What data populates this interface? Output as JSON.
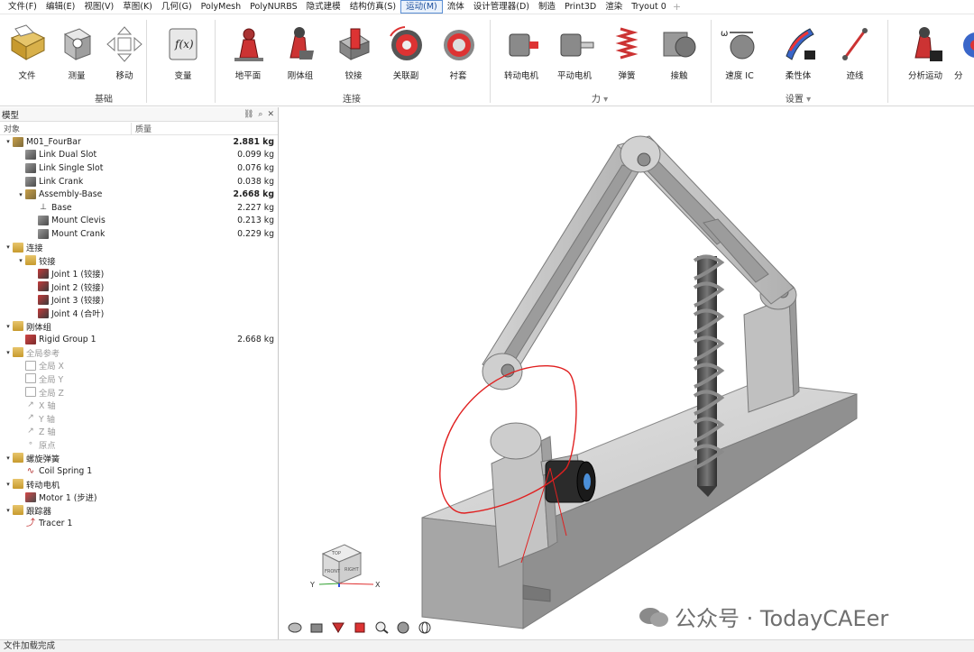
{
  "menu": {
    "items": [
      "文件(F)",
      "编辑(E)",
      "视图(V)",
      "草图(K)",
      "几何(G)",
      "PolyMesh",
      "PolyNURBS",
      "隐式建模",
      "结构仿真(S)",
      "运动(M)",
      "流体",
      "设计管理器(D)",
      "制造",
      "Print3D",
      "渲染",
      "Tryout 0"
    ],
    "active": "运动(M)",
    "plus": "+"
  },
  "ribbon": {
    "buttons": {
      "file": "文件",
      "measure": "测量",
      "move": "移动",
      "variable": "变量",
      "ground": "地平面",
      "rigid_group": "刚体组",
      "hinge": "铰接",
      "coupler": "关联副",
      "bushing": "衬套",
      "rot_motor": "转动电机",
      "lin_motor": "平动电机",
      "spring": "弹簧",
      "contact": "接触",
      "velocity_ic": "速度 IC",
      "flex_body": "柔性体",
      "tracer": "迹线",
      "analyze": "分析运动",
      "analyze2": "分"
    },
    "groups": {
      "basic": "基础",
      "connect": "连接",
      "force": "力",
      "setup": "设置"
    },
    "dropdown_marker": "▾"
  },
  "panel": {
    "title": "模型",
    "tools": [
      "⛓",
      "⌕",
      "✕"
    ],
    "col_object": "对象",
    "col_mass": "质量",
    "tree": [
      {
        "label": "M01_FourBar",
        "value": "2.881 kg",
        "bold": true,
        "depth": 0,
        "chev": "▾",
        "icon": "asm"
      },
      {
        "label": "Link Dual Slot",
        "value": "0.099 kg",
        "depth": 1,
        "chev": "",
        "icon": "part"
      },
      {
        "label": "Link Single Slot",
        "value": "0.076 kg",
        "depth": 1,
        "chev": "",
        "icon": "part"
      },
      {
        "label": "Link Crank",
        "value": "0.038 kg",
        "depth": 1,
        "chev": "",
        "icon": "part"
      },
      {
        "label": "Assembly-Base",
        "value": "2.668 kg",
        "bold": true,
        "depth": 1,
        "chev": "▾",
        "icon": "asm"
      },
      {
        "label": "Base",
        "value": "2.227 kg",
        "depth": 2,
        "chev": "",
        "icon": "ground"
      },
      {
        "label": "Mount Clevis",
        "value": "0.213 kg",
        "depth": 2,
        "chev": "",
        "icon": "part"
      },
      {
        "label": "Mount Crank",
        "value": "0.229 kg",
        "depth": 2,
        "chev": "",
        "icon": "part"
      },
      {
        "label": "连接",
        "value": "",
        "depth": 0,
        "chev": "▾",
        "icon": "folder"
      },
      {
        "label": "铰接",
        "value": "",
        "depth": 1,
        "chev": "▾",
        "icon": "folder"
      },
      {
        "label": "Joint 1 (铰接)",
        "value": "",
        "depth": 2,
        "chev": "",
        "icon": "joint"
      },
      {
        "label": "Joint 2 (铰接)",
        "value": "",
        "depth": 2,
        "chev": "",
        "icon": "joint"
      },
      {
        "label": "Joint 3 (铰接)",
        "value": "",
        "depth": 2,
        "chev": "",
        "icon": "joint"
      },
      {
        "label": "Joint 4 (合叶)",
        "value": "",
        "depth": 2,
        "chev": "",
        "icon": "joint"
      },
      {
        "label": "刚体组",
        "value": "",
        "depth": 0,
        "chev": "▾",
        "icon": "folder"
      },
      {
        "label": "Rigid Group 1",
        "value": "2.668 kg",
        "depth": 1,
        "chev": "",
        "icon": "rigid"
      },
      {
        "label": "全局参考",
        "value": "",
        "depth": 0,
        "chev": "▾",
        "icon": "folder",
        "disabled": true
      },
      {
        "label": "全局 X",
        "value": "",
        "depth": 1,
        "chev": "",
        "icon": "ref",
        "disabled": true
      },
      {
        "label": "全局 Y",
        "value": "",
        "depth": 1,
        "chev": "",
        "icon": "ref",
        "disabled": true
      },
      {
        "label": "全局 Z",
        "value": "",
        "depth": 1,
        "chev": "",
        "icon": "ref",
        "disabled": true
      },
      {
        "label": "X 轴",
        "value": "",
        "depth": 1,
        "chev": "",
        "icon": "axis",
        "disabled": true
      },
      {
        "label": "Y 轴",
        "value": "",
        "depth": 1,
        "chev": "",
        "icon": "axis",
        "disabled": true
      },
      {
        "label": "Z 轴",
        "value": "",
        "depth": 1,
        "chev": "",
        "icon": "axis",
        "disabled": true
      },
      {
        "label": "原点",
        "value": "",
        "depth": 1,
        "chev": "",
        "icon": "origin",
        "disabled": true
      },
      {
        "label": "螺旋弹簧",
        "value": "",
        "depth": 0,
        "chev": "▾",
        "icon": "folder"
      },
      {
        "label": "Coil Spring 1",
        "value": "",
        "depth": 1,
        "chev": "",
        "icon": "spring"
      },
      {
        "label": "转动电机",
        "value": "",
        "depth": 0,
        "chev": "▾",
        "icon": "folder"
      },
      {
        "label": "Motor 1 (步进)",
        "value": "",
        "depth": 1,
        "chev": "",
        "icon": "motor"
      },
      {
        "label": "跟踪器",
        "value": "",
        "depth": 0,
        "chev": "▾",
        "icon": "folder"
      },
      {
        "label": "Tracer 1",
        "value": "",
        "depth": 1,
        "chev": "",
        "icon": "tracer"
      }
    ]
  },
  "viewport": {
    "cube": {
      "top": "TOP",
      "front": "FRONT",
      "right": "RIGHT"
    },
    "axes": {
      "x": "X",
      "y": "Y"
    },
    "watermark": "公众号 · TodayCAEer"
  },
  "status": {
    "text": "文件加载完成"
  },
  "colors": {
    "accent": "#1d4f9c",
    "tracer_curve": "#e02020",
    "model_gray": "#b8b8b8"
  }
}
